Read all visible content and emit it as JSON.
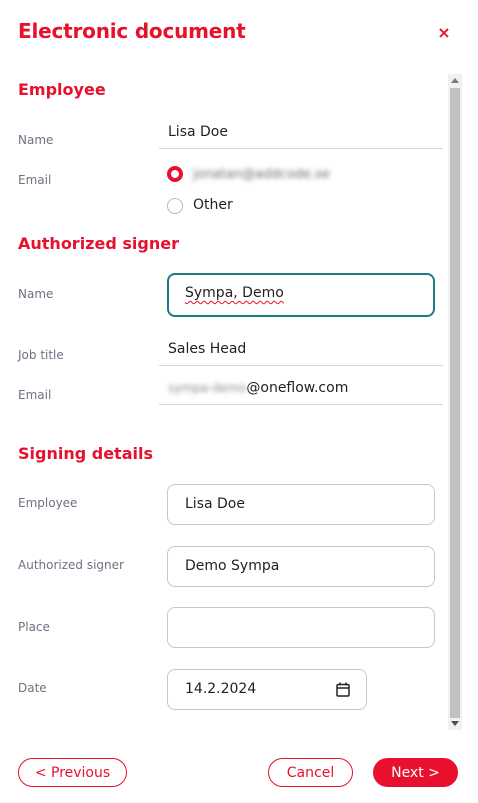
{
  "dialog": {
    "title": "Electronic document",
    "close_symbol": "×"
  },
  "employee": {
    "heading": "Employee",
    "name_label": "Name",
    "name_value": "Lisa Doe",
    "email_label": "Email",
    "email_option": "jonatan@addcode.se",
    "other_option": "Other"
  },
  "authorized_signer": {
    "heading": "Authorized signer",
    "name_label": "Name",
    "name_value": "Sympa, Demo",
    "job_title_label": "Job title",
    "job_title_value": "Sales Head",
    "email_label": "Email",
    "email_local": "sympa-demo",
    "email_domain": "@oneflow.com"
  },
  "signing_details": {
    "heading": "Signing details",
    "employee_label": "Employee",
    "employee_value": "Lisa Doe",
    "authorized_signer_label": "Authorized signer",
    "authorized_signer_value": "Demo Sympa",
    "place_label": "Place",
    "place_value": "",
    "date_label": "Date",
    "date_value": "14.2.2024"
  },
  "footer": {
    "previous_label": "< Previous",
    "cancel_label": "Cancel",
    "next_label": "Next >"
  },
  "colors": {
    "accent": "#e8112d",
    "focus": "#1e7b86",
    "label": "#6f7280"
  },
  "icons": {
    "close": "close-icon",
    "calendar": "calendar-icon"
  }
}
